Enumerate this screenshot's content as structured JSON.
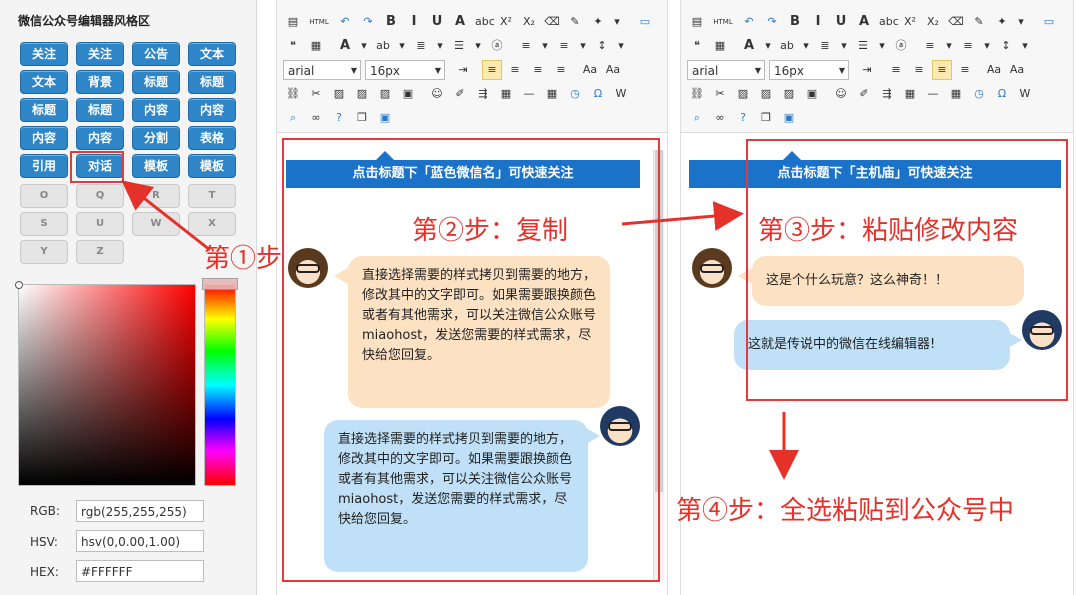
{
  "left_panel": {
    "title": "微信公众号编辑器风格区",
    "style_buttons": [
      [
        "关注",
        "关注",
        "公告",
        "文本"
      ],
      [
        "文本",
        "背景",
        "标题",
        "标题"
      ],
      [
        "标题",
        "标题",
        "内容",
        "内容"
      ],
      [
        "内容",
        "内容",
        "分割",
        "表格"
      ],
      [
        "引用",
        "对话",
        "模板",
        "模板"
      ]
    ],
    "letter_buttons": [
      [
        "O",
        "Q",
        "R",
        "T"
      ],
      [
        "S",
        "U",
        "W",
        "X"
      ],
      [
        "Y",
        "Z"
      ]
    ],
    "color": {
      "rgb_label": "RGB:",
      "rgb_value": "rgb(255,255,255)",
      "hsv_label": "HSV:",
      "hsv_value": "hsv(0,0.00,1.00)",
      "hex_label": "HEX:",
      "hex_value": "#FFFFFF"
    }
  },
  "toolbar": {
    "font_family": "arial",
    "font_size": "16px",
    "html_label": "HTML"
  },
  "editor_left": {
    "banner": "点击标题下「蓝色微信名」可快速关注",
    "bubble_1": "直接选择需要的样式拷贝到需要的地方，修改其中的文字即可。如果需要跟换颜色或者有其他需求，可以关注微信公众账号miaohost，发送您需要的样式需求，尽快给您回复。",
    "bubble_2": "直接选择需要的样式拷贝到需要的地方，修改其中的文字即可。如果需要跟换颜色或者有其他需求，可以关注微信公众账号miaohost，发送您需要的样式需求，尽快给您回复。"
  },
  "editor_right": {
    "banner": "点击标题下「主机庙」可快速关注",
    "bubble_1": "这是个什么玩意？这么神奇！！",
    "bubble_2": "这就是传说中的微信在线编辑器!"
  },
  "steps": {
    "step1": "第①步",
    "step2": "第②步：复制",
    "step3": "第③步：粘贴修改内容",
    "step4": "第④步：全选粘贴到公众号中"
  },
  "annotation_color": "#e4322b",
  "button_color": "#2e86c8"
}
